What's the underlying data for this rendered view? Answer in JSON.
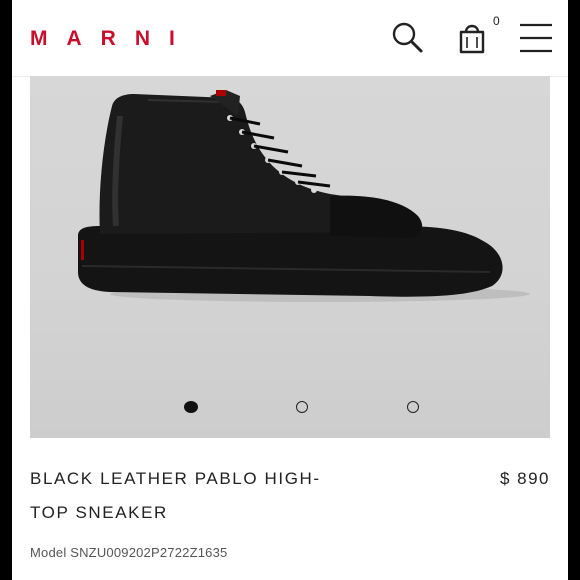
{
  "header": {
    "logo_text": "MARNI",
    "bag_count": "0",
    "icons": [
      "search-icon",
      "shopping-bag-icon",
      "hamburger-menu-icon"
    ],
    "brand_color": "#c8102e"
  },
  "gallery": {
    "slide_count": 3,
    "active_slide": 1
  },
  "product": {
    "name": "BLACK LEATHER PABLO HIGH-TOP SNEAKER",
    "name_line1": "BLACK LEATHER PABLO HIGH-",
    "name_line2": "TOP SNEAKER",
    "price": "$ 890",
    "model": "Model SNZU009202P2722Z1635"
  }
}
